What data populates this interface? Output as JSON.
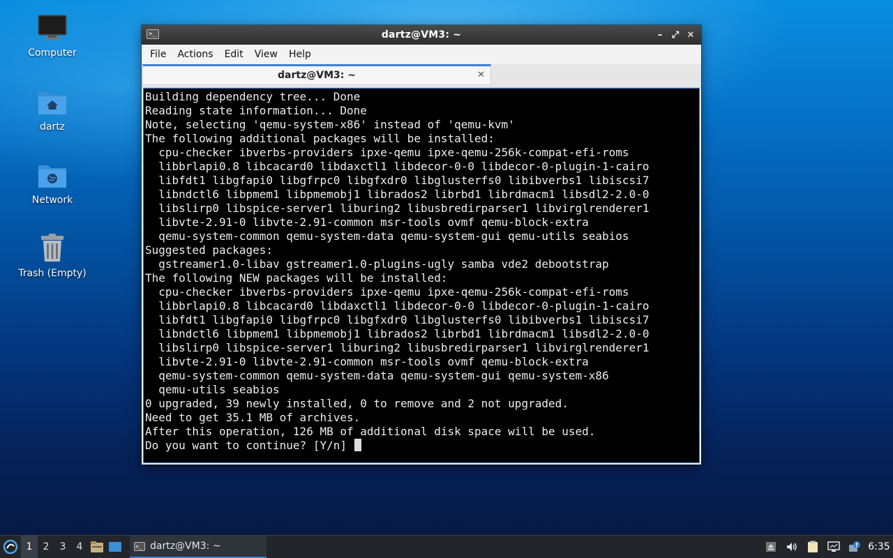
{
  "desktop": {
    "icons": [
      {
        "label": "Computer",
        "icon": "computer-icon"
      },
      {
        "label": "dartz",
        "icon": "home-folder-icon"
      },
      {
        "label": "Network",
        "icon": "network-folder-icon"
      },
      {
        "label": "Trash (Empty)",
        "icon": "trash-icon"
      }
    ]
  },
  "window": {
    "title": "dartz@VM3: ~",
    "menu": [
      "File",
      "Actions",
      "Edit",
      "View",
      "Help"
    ],
    "tab_label": "dartz@VM3: ~",
    "controls": {
      "minimize": "–",
      "maximize": "⤢",
      "close": "✕"
    }
  },
  "terminal": {
    "lines": [
      "Building dependency tree... Done",
      "Reading state information... Done",
      "Note, selecting 'qemu-system-x86' instead of 'qemu-kvm'",
      "The following additional packages will be installed:",
      "  cpu-checker ibverbs-providers ipxe-qemu ipxe-qemu-256k-compat-efi-roms",
      "  libbrlapi0.8 libcacard0 libdaxctl1 libdecor-0-0 libdecor-0-plugin-1-cairo",
      "  libfdt1 libgfapi0 libgfrpc0 libgfxdr0 libglusterfs0 libibverbs1 libiscsi7",
      "  libndctl6 libpmem1 libpmemobj1 librados2 librbd1 librdmacm1 libsdl2-2.0-0",
      "  libslirp0 libspice-server1 liburing2 libusbredirparser1 libvirglrenderer1",
      "  libvte-2.91-0 libvte-2.91-common msr-tools ovmf qemu-block-extra",
      "  qemu-system-common qemu-system-data qemu-system-gui qemu-utils seabios",
      "Suggested packages:",
      "  gstreamer1.0-libav gstreamer1.0-plugins-ugly samba vde2 debootstrap",
      "The following NEW packages will be installed:",
      "  cpu-checker ibverbs-providers ipxe-qemu ipxe-qemu-256k-compat-efi-roms",
      "  libbrlapi0.8 libcacard0 libdaxctl1 libdecor-0-0 libdecor-0-plugin-1-cairo",
      "  libfdt1 libgfapi0 libgfrpc0 libgfxdr0 libglusterfs0 libibverbs1 libiscsi7",
      "  libndctl6 libpmem1 libpmemobj1 librados2 librbd1 librdmacm1 libsdl2-2.0-0",
      "  libslirp0 libspice-server1 liburing2 libusbredirparser1 libvirglrenderer1",
      "  libvte-2.91-0 libvte-2.91-common msr-tools ovmf qemu-block-extra",
      "  qemu-system-common qemu-system-data qemu-system-gui qemu-system-x86",
      "  qemu-utils seabios",
      "0 upgraded, 39 newly installed, 0 to remove and 2 not upgraded.",
      "Need to get 35.1 MB of archives.",
      "After this operation, 126 MB of additional disk space will be used."
    ],
    "prompt": "Do you want to continue? [Y/n] "
  },
  "taskbar": {
    "workspaces": [
      "1",
      "2",
      "3",
      "4"
    ],
    "active_workspace": "1",
    "task_label": "dartz@VM3: ~",
    "clock": "6:35"
  },
  "colors": {
    "accent": "#3e7fd0",
    "terminal_bg": "#000000",
    "terminal_fg": "#ededed",
    "taskbar_bg": "#22252a"
  }
}
